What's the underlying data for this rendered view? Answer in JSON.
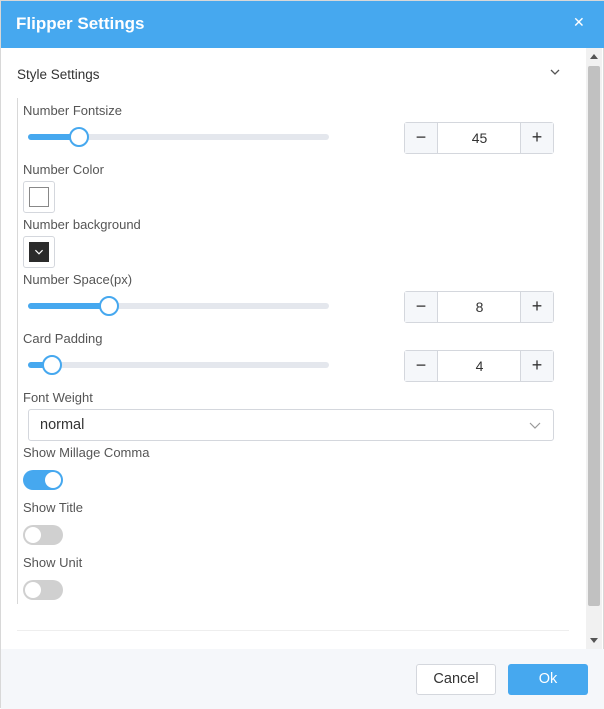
{
  "dialog": {
    "title": "Flipper Settings",
    "close_icon": "close-icon"
  },
  "section": {
    "title": "Style Settings",
    "expanded": true
  },
  "fields": {
    "number_fontsize": {
      "label": "Number Fontsize",
      "value": "45",
      "slider_fraction": 0.17
    },
    "number_color": {
      "label": "Number Color",
      "color": "#ffffff"
    },
    "number_background": {
      "label": "Number background",
      "color": "#2b2b2b"
    },
    "number_space": {
      "label": "Number Space(px)",
      "value": "8",
      "slider_fraction": 0.27
    },
    "card_padding": {
      "label": "Card Padding",
      "value": "4",
      "slider_fraction": 0.08
    },
    "font_weight": {
      "label": "Font Weight",
      "value": "normal"
    },
    "show_millage_comma": {
      "label": "Show Millage Comma",
      "on": true
    },
    "show_title": {
      "label": "Show Title",
      "on": false
    },
    "show_unit": {
      "label": "Show Unit",
      "on": false
    }
  },
  "footer": {
    "cancel_label": "Cancel",
    "ok_label": "Ok"
  },
  "colors": {
    "accent": "#46a8ef",
    "toggle_off": "#d0d0d0"
  }
}
